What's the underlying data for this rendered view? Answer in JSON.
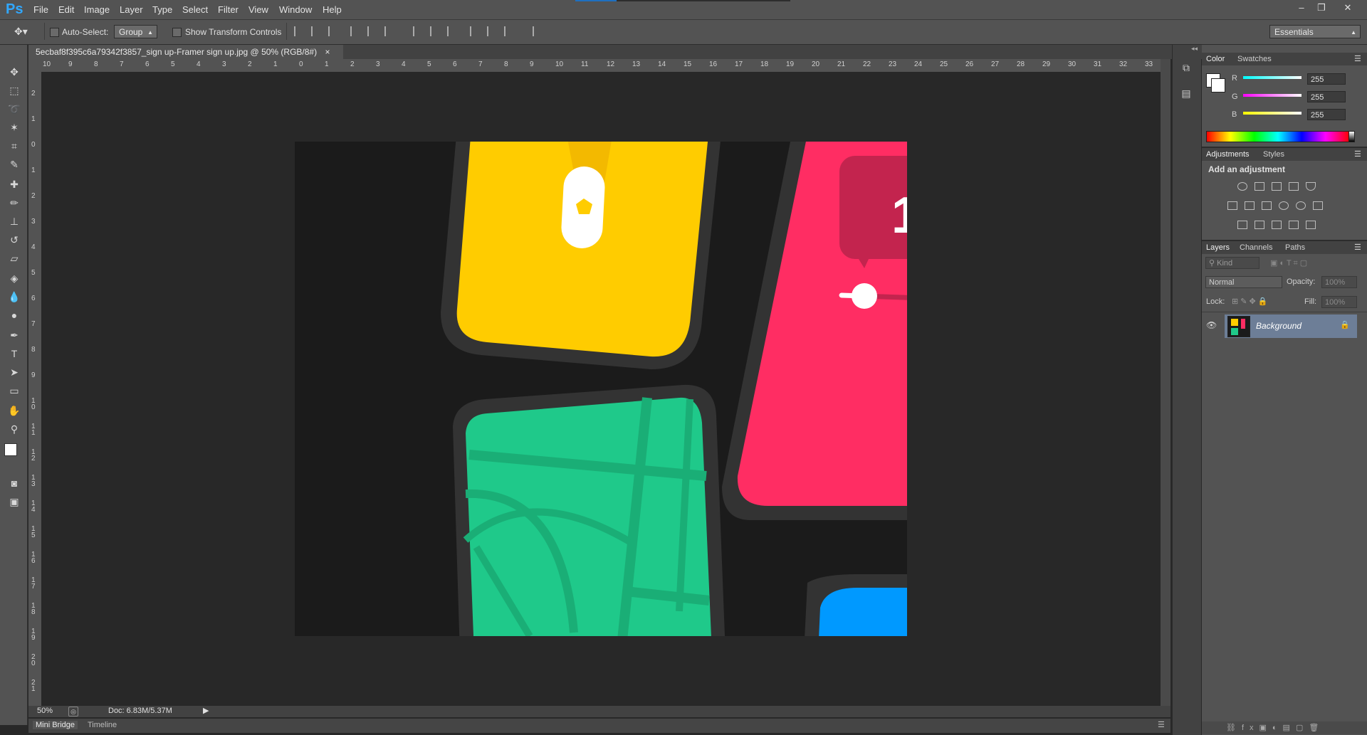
{
  "app": {
    "logo": "Ps"
  },
  "menu": [
    "File",
    "Edit",
    "Image",
    "Layer",
    "Type",
    "Select",
    "Filter",
    "View",
    "Window",
    "Help"
  ],
  "window_controls": {
    "minimize": "–",
    "restore": "❐",
    "close": "✕"
  },
  "options": {
    "auto_select_label": "Auto-Select:",
    "auto_select_value": "Group",
    "transform_label": "Show Transform Controls",
    "workspace_value": "Essentials"
  },
  "document": {
    "tab_title": "5ecbaf8f395c6a79342f3857_sign up-Framer sign up.jpg @ 50% (RGB/8#)",
    "tab_close": "×",
    "zoom": "50%",
    "doc_size": "Doc: 6.83M/5.37M"
  },
  "rulers": {
    "top": [
      "10",
      "9",
      "8",
      "7",
      "6",
      "5",
      "4",
      "3",
      "2",
      "1",
      "0",
      "1",
      "2",
      "3",
      "4",
      "5",
      "6",
      "7",
      "8",
      "9",
      "10",
      "11",
      "12",
      "13",
      "14",
      "15",
      "16",
      "17",
      "18",
      "19",
      "20",
      "21",
      "22",
      "23",
      "24",
      "25",
      "26",
      "27",
      "28",
      "29",
      "30",
      "31",
      "32",
      "33"
    ],
    "left": [
      "2",
      "1",
      "0",
      "1",
      "2",
      "3",
      "4",
      "5",
      "6",
      "7",
      "8",
      "9",
      "1 0",
      "1 1",
      "1 2",
      "1 3",
      "1 4",
      "1 5",
      "1 6",
      "1 7",
      "1 8",
      "1 9",
      "2 0",
      "2 1"
    ]
  },
  "bottom_tabs": {
    "mini_bridge": "Mini Bridge",
    "timeline": "Timeline"
  },
  "color_panel": {
    "tab_color": "Color",
    "tab_swatches": "Swatches",
    "r_label": "R",
    "g_label": "G",
    "b_label": "B",
    "r": "255",
    "g": "255",
    "b": "255"
  },
  "adjustments_panel": {
    "tab_adjustments": "Adjustments",
    "tab_styles": "Styles",
    "heading": "Add an adjustment"
  },
  "layers_panel": {
    "tab_layers": "Layers",
    "tab_channels": "Channels",
    "tab_paths": "Paths",
    "kind_filter": "Kind",
    "blend_mode": "Normal",
    "opacity_label": "Opacity:",
    "opacity_value": "100%",
    "lock_label": "Lock:",
    "fill_label": "Fill:",
    "fill_value": "100%",
    "layers": [
      {
        "name": "Background",
        "locked": true,
        "visible": true
      }
    ]
  },
  "artwork": {
    "pill_number": "1",
    "colors": {
      "yellow": "#ffcc00",
      "pink": "#ff2d63",
      "green": "#1fc98a",
      "blue": "#0099ff",
      "frame": "#333333",
      "background": "#1b1b1b"
    }
  }
}
